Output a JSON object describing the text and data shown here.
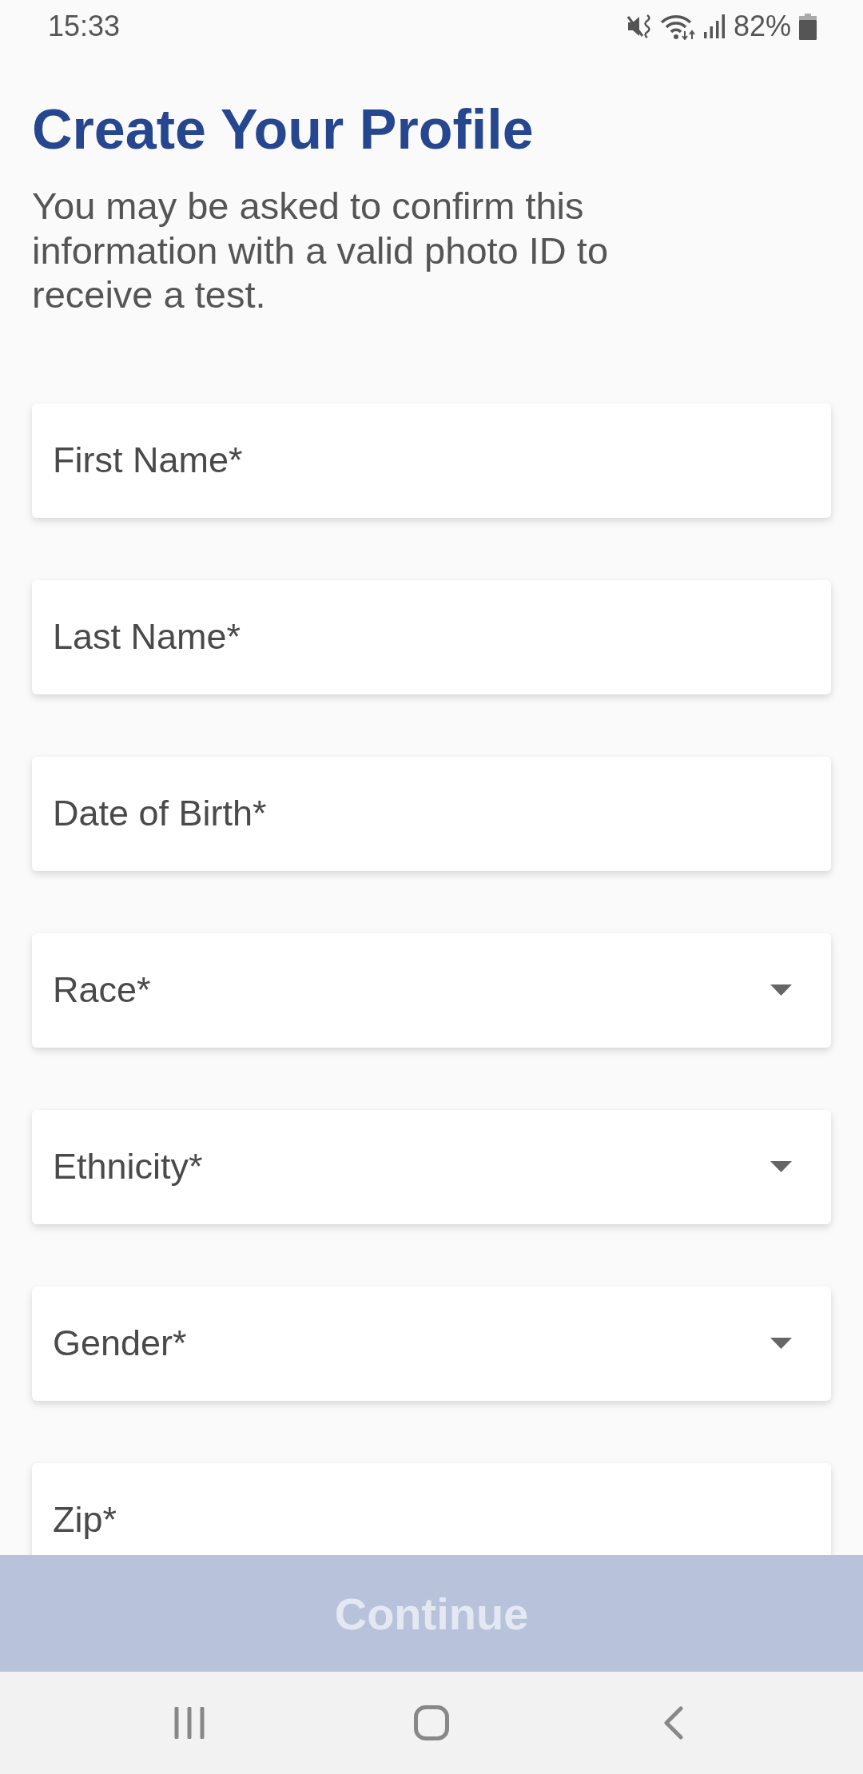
{
  "status_bar": {
    "time": "15:33",
    "battery": "82%"
  },
  "header": {
    "title": "Create Your Profile",
    "subtitle": "You may be asked to confirm this information with a valid photo ID to receive a test."
  },
  "fields": [
    {
      "kind": "text",
      "placeholder": "First Name*"
    },
    {
      "kind": "text",
      "placeholder": "Last Name*"
    },
    {
      "kind": "text",
      "placeholder": "Date of Birth*"
    },
    {
      "kind": "select",
      "placeholder": "Race*"
    },
    {
      "kind": "select",
      "placeholder": "Ethnicity*"
    },
    {
      "kind": "select",
      "placeholder": "Gender*"
    },
    {
      "kind": "text",
      "placeholder": "Zip*"
    }
  ],
  "continue_button": {
    "label": "Continue",
    "disabled": true
  }
}
